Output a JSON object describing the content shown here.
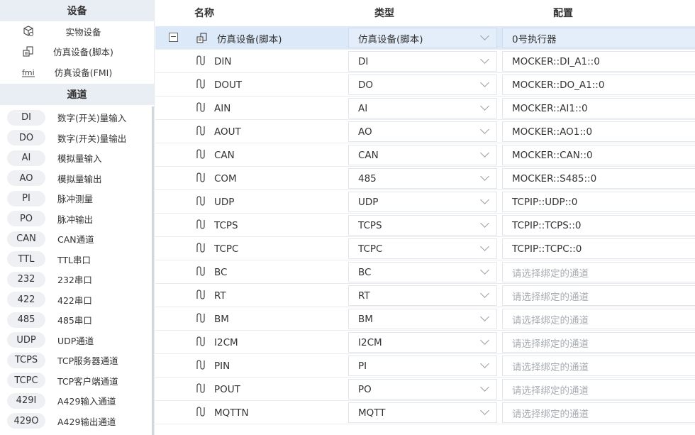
{
  "sidebar": {
    "devices_header": "设备",
    "devices": [
      {
        "label": "实物设备",
        "icon": "physical-device-icon"
      },
      {
        "label": "仿真设备(脚本)",
        "icon": "script-device-icon"
      },
      {
        "label": "仿真设备(FMI)",
        "icon": "fmi-device-icon"
      }
    ],
    "channels_header": "通道",
    "channels": [
      {
        "badge": "DI",
        "label": "数字(开关)量输入"
      },
      {
        "badge": "DO",
        "label": "数字(开关)量输出"
      },
      {
        "badge": "AI",
        "label": "模拟量输入"
      },
      {
        "badge": "AO",
        "label": "模拟量输出"
      },
      {
        "badge": "PI",
        "label": "脉冲测量"
      },
      {
        "badge": "PO",
        "label": "脉冲输出"
      },
      {
        "badge": "CAN",
        "label": "CAN通道"
      },
      {
        "badge": "TTL",
        "label": "TTL串口"
      },
      {
        "badge": "232",
        "label": "232串口"
      },
      {
        "badge": "422",
        "label": "422串口"
      },
      {
        "badge": "485",
        "label": "485串口"
      },
      {
        "badge": "UDP",
        "label": "UDP通道"
      },
      {
        "badge": "TCPS",
        "label": "TCP服务器通道"
      },
      {
        "badge": "TCPC",
        "label": "TCP客户端通道"
      },
      {
        "badge": "429I",
        "label": "A429输入通道"
      },
      {
        "badge": "429O",
        "label": "A429输出通道"
      }
    ]
  },
  "table": {
    "headers": {
      "name": "名称",
      "type": "类型",
      "config": "配置"
    },
    "device_row": {
      "collapse": "−",
      "name": "仿真设备(脚本)",
      "type": "仿真设备(脚本)",
      "config": "0号执行器"
    },
    "rows": [
      {
        "name": "DIN",
        "type": "DI",
        "config": "MOCKER::DI_A1::0",
        "placeholder": false
      },
      {
        "name": "DOUT",
        "type": "DO",
        "config": "MOCKER::DO_A1::0",
        "placeholder": false
      },
      {
        "name": "AIN",
        "type": "AI",
        "config": "MOCKER::AI1::0",
        "placeholder": false
      },
      {
        "name": "AOUT",
        "type": "AO",
        "config": "MOCKER::AO1::0",
        "placeholder": false
      },
      {
        "name": "CAN",
        "type": "CAN",
        "config": "MOCKER::CAN::0",
        "placeholder": false
      },
      {
        "name": "COM",
        "type": "485",
        "config": "MOCKER::S485::0",
        "placeholder": false
      },
      {
        "name": "UDP",
        "type": "UDP",
        "config": "TCPIP::UDP::0",
        "placeholder": false
      },
      {
        "name": "TCPS",
        "type": "TCPS",
        "config": "TCPIP::TCPS::0",
        "placeholder": false
      },
      {
        "name": "TCPC",
        "type": "TCPC",
        "config": "TCPIP::TCPC::0",
        "placeholder": false
      },
      {
        "name": "BC",
        "type": "BC",
        "config": "请选择绑定的通道",
        "placeholder": true
      },
      {
        "name": "RT",
        "type": "RT",
        "config": "请选择绑定的通道",
        "placeholder": true
      },
      {
        "name": "BM",
        "type": "BM",
        "config": "请选择绑定的通道",
        "placeholder": true
      },
      {
        "name": "I2CM",
        "type": "I2CM",
        "config": "请选择绑定的通道",
        "placeholder": true
      },
      {
        "name": "PIN",
        "type": "PI",
        "config": "请选择绑定的通道",
        "placeholder": true
      },
      {
        "name": "POUT",
        "type": "PO",
        "config": "请选择绑定的通道",
        "placeholder": true
      },
      {
        "name": "MQTTN",
        "type": "MQTT",
        "config": "请选择绑定的通道",
        "placeholder": true
      }
    ]
  },
  "colors": {
    "selected_row": "#dce9f8",
    "section_header": "#e9eef4",
    "badge": "#eef0f3",
    "placeholder_text": "#a8adb3"
  }
}
